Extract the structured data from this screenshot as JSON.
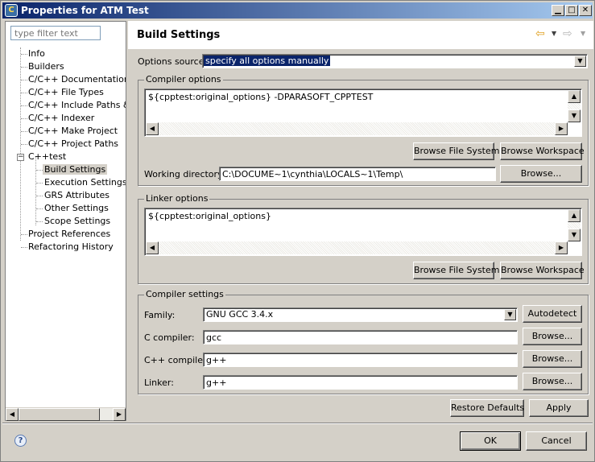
{
  "window": {
    "title": "Properties for ATM Test"
  },
  "filter": {
    "placeholder": "type filter text"
  },
  "tree": {
    "items": [
      {
        "label": "Info"
      },
      {
        "label": "Builders"
      },
      {
        "label": "C/C++ Documentation"
      },
      {
        "label": "C/C++ File Types"
      },
      {
        "label": "C/C++ Include Paths & S"
      },
      {
        "label": "C/C++ Indexer"
      },
      {
        "label": "C/C++ Make Project"
      },
      {
        "label": "C/C++ Project Paths"
      },
      {
        "label": "C++test"
      },
      {
        "label": "Build Settings"
      },
      {
        "label": "Execution Settings"
      },
      {
        "label": "GRS Attributes"
      },
      {
        "label": "Other Settings"
      },
      {
        "label": "Scope Settings"
      },
      {
        "label": "Project References"
      },
      {
        "label": "Refactoring History"
      }
    ]
  },
  "page": {
    "title": "Build Settings"
  },
  "options_source": {
    "label": "Options source:",
    "value": "specify all options manually"
  },
  "compiler_options": {
    "title": "Compiler options",
    "text": "${cpptest:original_options} -DPARASOFT_CPPTEST",
    "browse_fs": "Browse File System",
    "browse_ws": "Browse Workspace",
    "wd_label": "Working directory:",
    "wd_value": "C:\\DOCUME~1\\cynthia\\LOCALS~1\\Temp\\",
    "browse": "Browse..."
  },
  "linker_options": {
    "title": "Linker options",
    "text": "${cpptest:original_options}",
    "browse_fs": "Browse File System",
    "browse_ws": "Browse Workspace"
  },
  "compiler_settings": {
    "title": "Compiler settings",
    "family_label": "Family:",
    "family_value": "GNU GCC 3.4.x",
    "autodetect": "Autodetect",
    "c_label": "C compiler:",
    "c_value": "gcc",
    "cpp_label": "C++ compiler:",
    "cpp_value": "g++",
    "linker_label": "Linker:",
    "linker_value": "g++",
    "browse": "Browse..."
  },
  "actions": {
    "restore": "Restore Defaults",
    "apply": "Apply"
  },
  "footer": {
    "ok": "OK",
    "cancel": "Cancel"
  }
}
